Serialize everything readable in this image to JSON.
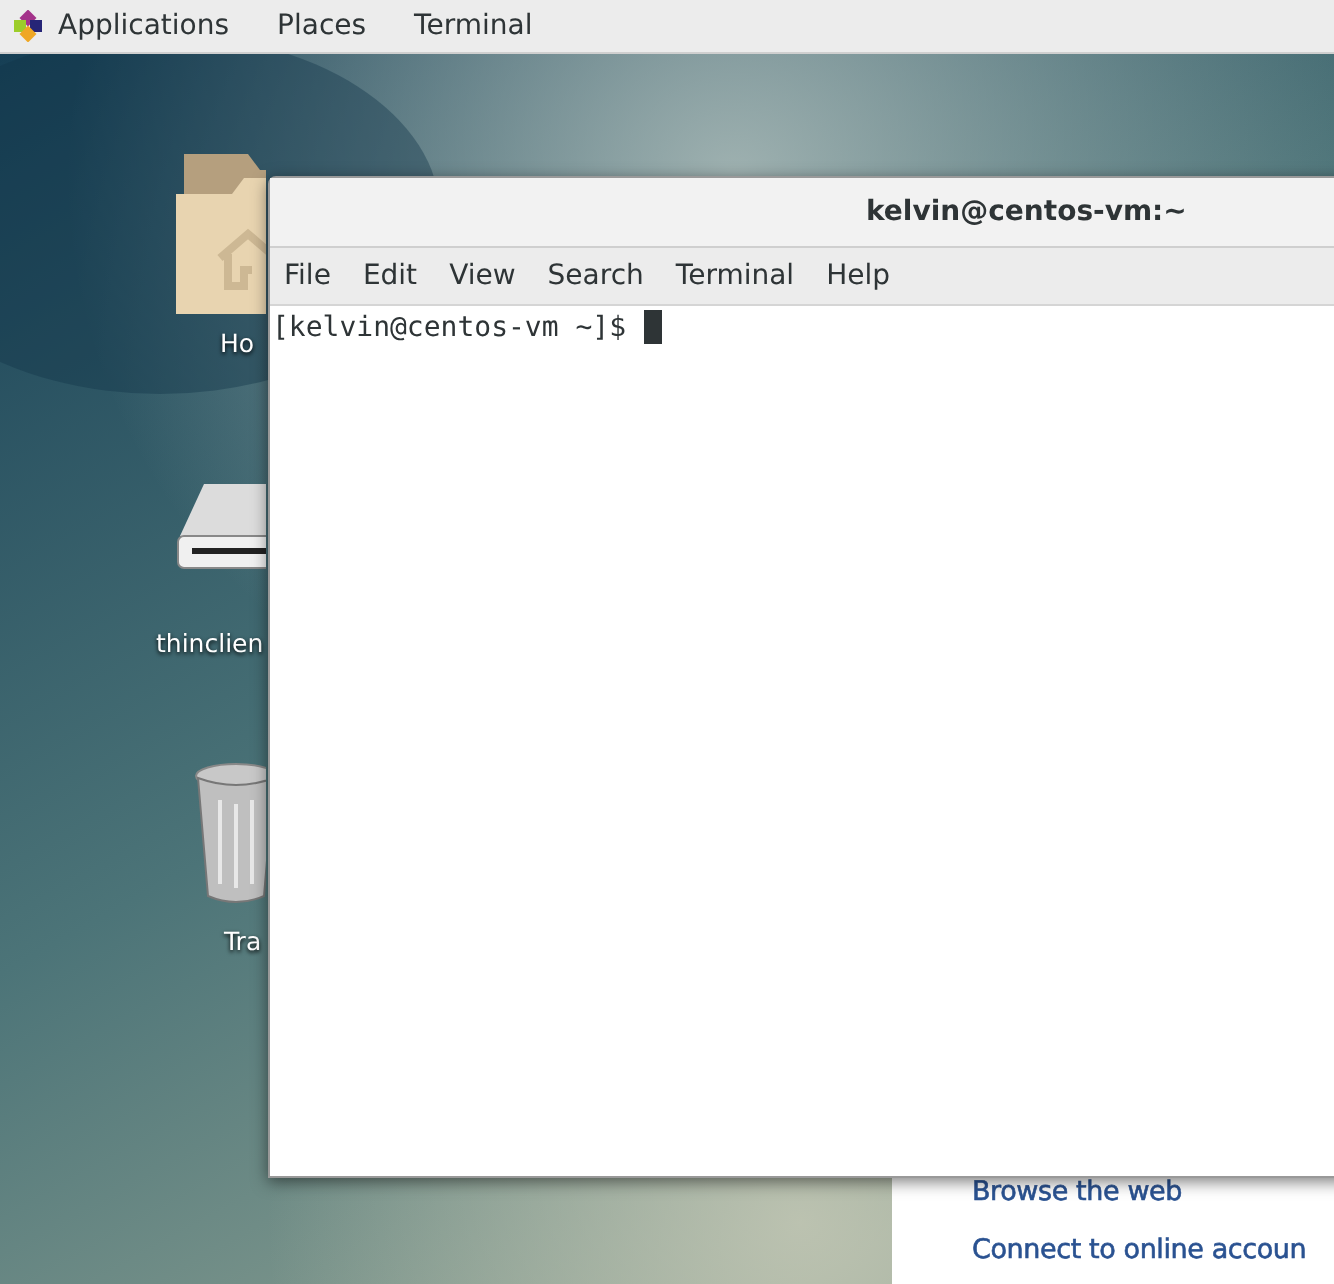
{
  "top_bar": {
    "menus": [
      "Applications",
      "Places",
      "Terminal"
    ]
  },
  "desktop_icons": [
    {
      "kind": "folder",
      "label": "Ho"
    },
    {
      "kind": "drive",
      "label": "thinclien"
    },
    {
      "kind": "trash",
      "label": "Tra"
    }
  ],
  "terminal": {
    "title": "kelvin@centos-vm:~",
    "menu": [
      "File",
      "Edit",
      "View",
      "Search",
      "Terminal",
      "Help"
    ],
    "prompt": "[kelvin@centos-vm ~]$"
  },
  "welcome": {
    "links": [
      "Browse the web",
      "Connect to online accoun"
    ]
  }
}
